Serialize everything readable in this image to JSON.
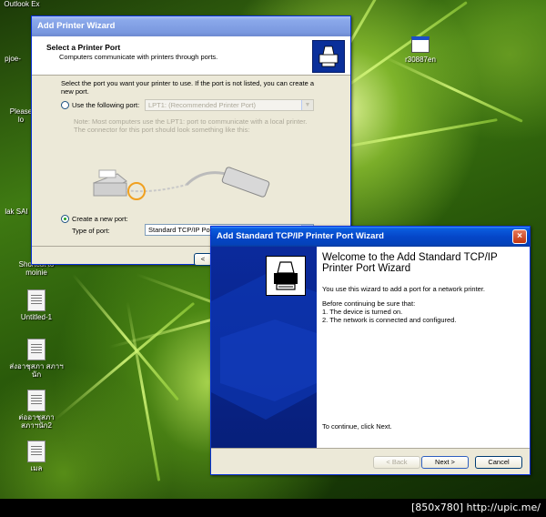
{
  "desktop": {
    "icons": [
      {
        "label": "Outlook Ex"
      },
      {
        "label": "pjoe-"
      },
      {
        "label": "Please lo"
      },
      {
        "label": "lak SAI"
      },
      {
        "label": "Shortcut to moinie"
      },
      {
        "label": "Untitled-1"
      },
      {
        "label": "ส่งอาชุสภา สภาฯนัก"
      },
      {
        "label": "ต่ออาชุสภา สภาฯนัก2"
      },
      {
        "label": "เมล"
      },
      {
        "label": "r30887en"
      }
    ]
  },
  "wizard1": {
    "title": "Add Printer Wizard",
    "header_title": "Select a Printer Port",
    "header_subtitle": "Computers communicate with printers through ports.",
    "instruction": "Select the port you want your printer to use.  If the port is not listed, you can create a new port.",
    "use_port_label": "Use the following port:",
    "use_port_value": "LPT1: (Recommended Printer Port)",
    "note": "Note: Most computers use the LPT1: port to communicate with a local printer. The connector for this port should look something like this:",
    "create_port_label": "Create a new port:",
    "type_label": "Type of port:",
    "type_value": "Standard TCP/IP Port",
    "back_fragment": "<"
  },
  "wizard2": {
    "title": "Add Standard TCP/IP Printer Port Wizard",
    "heading": "Welcome to the Add Standard TCP/IP Printer Port Wizard",
    "intro": "You use this wizard to add a port for a network printer.",
    "before": "Before continuing be sure that:",
    "item1": "1.  The device is turned on.",
    "item2": "2.  The network is connected and configured.",
    "continue": "To continue, click Next.",
    "back_label": "< Back",
    "next_label": "Next >",
    "cancel_label": "Cancel",
    "close_glyph": "×"
  },
  "caption": "[850x780] http://upic.me/"
}
